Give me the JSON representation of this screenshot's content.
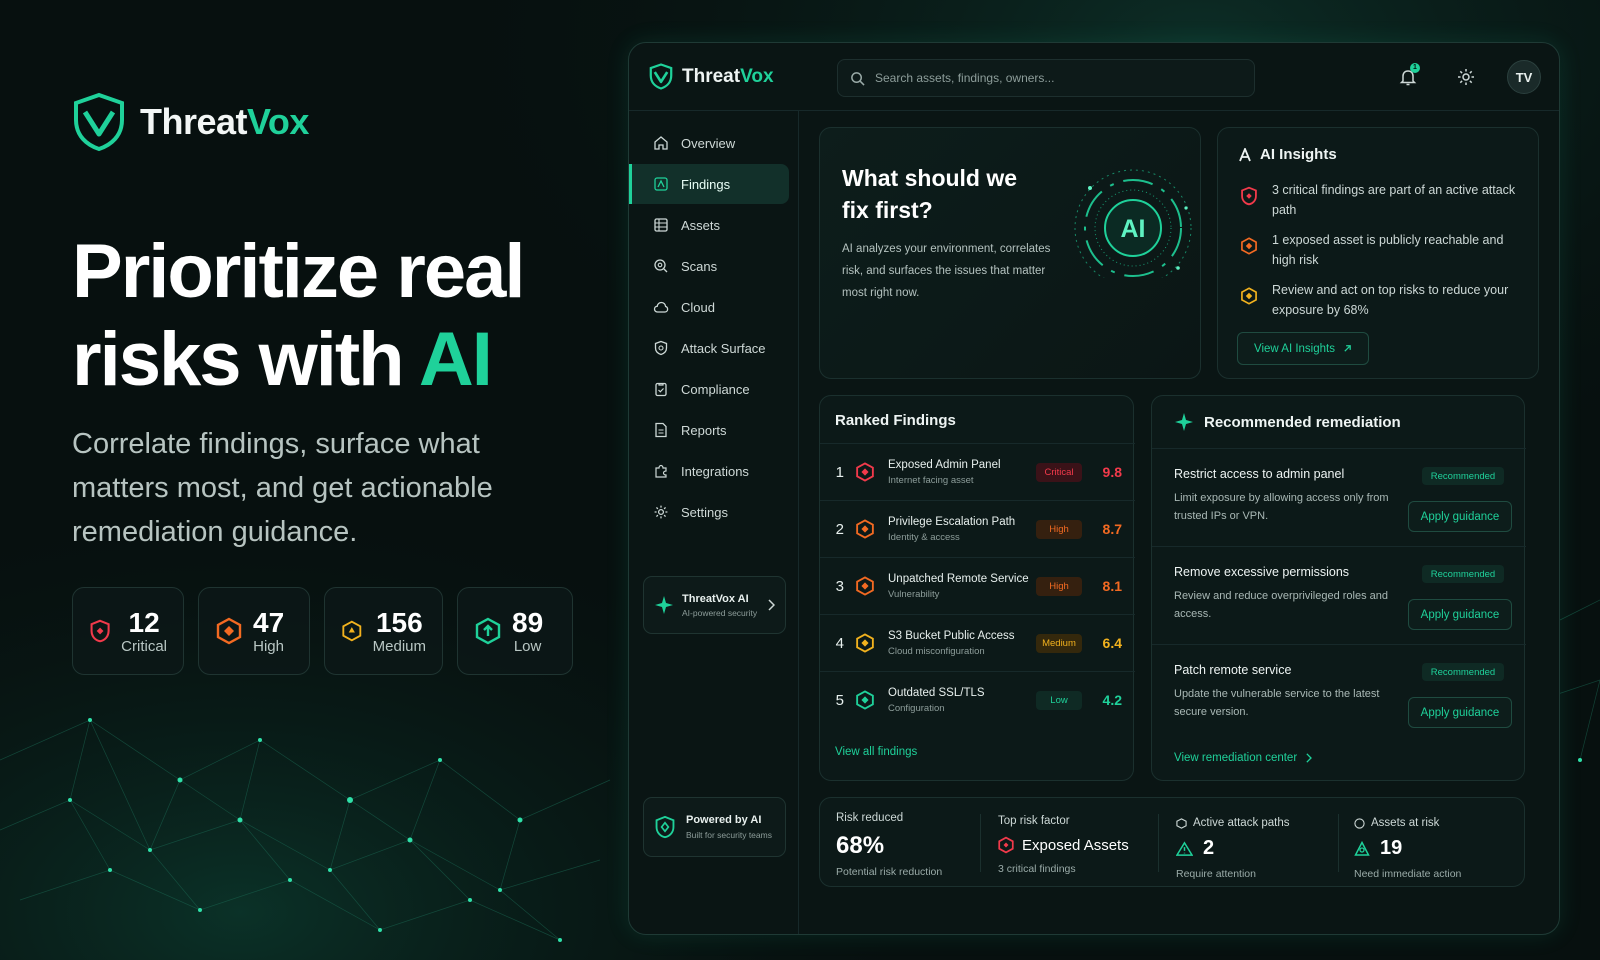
{
  "brand": {
    "name_a": "Threat",
    "name_b": "Vox"
  },
  "hero": {
    "line1": "Prioritize real",
    "line2a": "risks with ",
    "line2b": "AI"
  },
  "subhero": "Correlate findings, surface what matters most, and get actionable remediation guidance.",
  "stats": [
    {
      "value": "12",
      "label": "Critical",
      "color": "#f23a4b"
    },
    {
      "value": "47",
      "label": "High",
      "color": "#f36a22"
    },
    {
      "value": "156",
      "label": "Medium",
      "color": "#f2b21e"
    },
    {
      "value": "89",
      "label": "Low",
      "color": "#1fd19a"
    }
  ],
  "app": {
    "brand_a": "Threat",
    "brand_b": "Vox",
    "search_placeholder": "Search assets, findings, owners...",
    "notif_count": "1",
    "avatar": "TV"
  },
  "sidebar": {
    "items": [
      {
        "label": "Overview",
        "icon": "home-icon"
      },
      {
        "label": "Findings",
        "icon": "findings-icon",
        "active": true
      },
      {
        "label": "Assets",
        "icon": "assets-icon"
      },
      {
        "label": "Scans",
        "icon": "scan-icon"
      },
      {
        "label": "Cloud",
        "icon": "cloud-icon"
      },
      {
        "label": "Attack Surface",
        "icon": "shield-icon"
      },
      {
        "label": "Compliance",
        "icon": "clipboard-icon"
      },
      {
        "label": "Reports",
        "icon": "report-icon"
      },
      {
        "label": "Integrations",
        "icon": "puzzle-icon"
      },
      {
        "label": "Settings",
        "icon": "gear-icon"
      }
    ],
    "ai_card": {
      "title": "ThreatVox AI",
      "subtitle": "AI-powered security"
    },
    "powered": {
      "title": "Powered by AI",
      "subtitle": "Built for security teams"
    }
  },
  "hero_panel": {
    "heading": "What should we fix first?",
    "description": "AI analyzes your environment, correlates risk, and surfaces the issues that matter most right now.",
    "orb_label": "AI"
  },
  "insights": {
    "title": "AI Insights",
    "items": [
      {
        "text": "3 critical findings are part of an active attack path",
        "color": "#f23a4b"
      },
      {
        "text": "1 exposed asset is publicly reachable and high risk",
        "color": "#f36a22"
      },
      {
        "text": "Review and act on top risks to reduce your exposure by 68%",
        "color": "#f2b21e"
      }
    ],
    "button": "View AI Insights"
  },
  "ranked": {
    "title": "Ranked Findings",
    "rows": [
      {
        "rank": "1",
        "title": "Exposed Admin Panel",
        "subtitle": "Internet facing asset",
        "severity": "Critical",
        "score": "9.8",
        "color": "#f23a4b"
      },
      {
        "rank": "2",
        "title": "Privilege Escalation Path",
        "subtitle": "Identity & access",
        "severity": "High",
        "score": "8.7",
        "color": "#f36a22"
      },
      {
        "rank": "3",
        "title": "Unpatched Remote Service",
        "subtitle": "Vulnerability",
        "severity": "High",
        "score": "8.1",
        "color": "#f36a22"
      },
      {
        "rank": "4",
        "title": "S3 Bucket Public Access",
        "subtitle": "Cloud misconfiguration",
        "severity": "Medium",
        "score": "6.4",
        "color": "#f2b21e"
      },
      {
        "rank": "5",
        "title": "Outdated SSL/TLS",
        "subtitle": "Configuration",
        "severity": "Low",
        "score": "4.2",
        "color": "#1fd19a"
      }
    ],
    "link": "View all findings"
  },
  "remediation": {
    "title": "Recommended remediation",
    "rows": [
      {
        "title": "Restrict access to admin panel",
        "desc": "Limit exposure by allowing access only from trusted IPs or VPN.",
        "badge": "Recommended",
        "button": "Apply guidance"
      },
      {
        "title": "Remove excessive permissions",
        "desc": "Review and reduce overprivileged roles and access.",
        "badge": "Recommended",
        "button": "Apply guidance"
      },
      {
        "title": "Patch remote service",
        "desc": "Update the vulnerable service to the latest secure version.",
        "badge": "Recommended",
        "button": "Apply guidance"
      }
    ],
    "link": "View remediation center"
  },
  "metrics": {
    "risk_reduced": {
      "label": "Risk reduced",
      "value": "68%",
      "sub": "Potential risk reduction"
    },
    "top_factor": {
      "label": "Top risk factor",
      "value": "Exposed Assets",
      "sub": "3 critical findings"
    },
    "attack_paths": {
      "label": "Active attack paths",
      "value": "2",
      "sub": "Require attention"
    },
    "assets_risk": {
      "label": "Assets at risk",
      "value": "19",
      "sub": "Need immediate action"
    }
  }
}
